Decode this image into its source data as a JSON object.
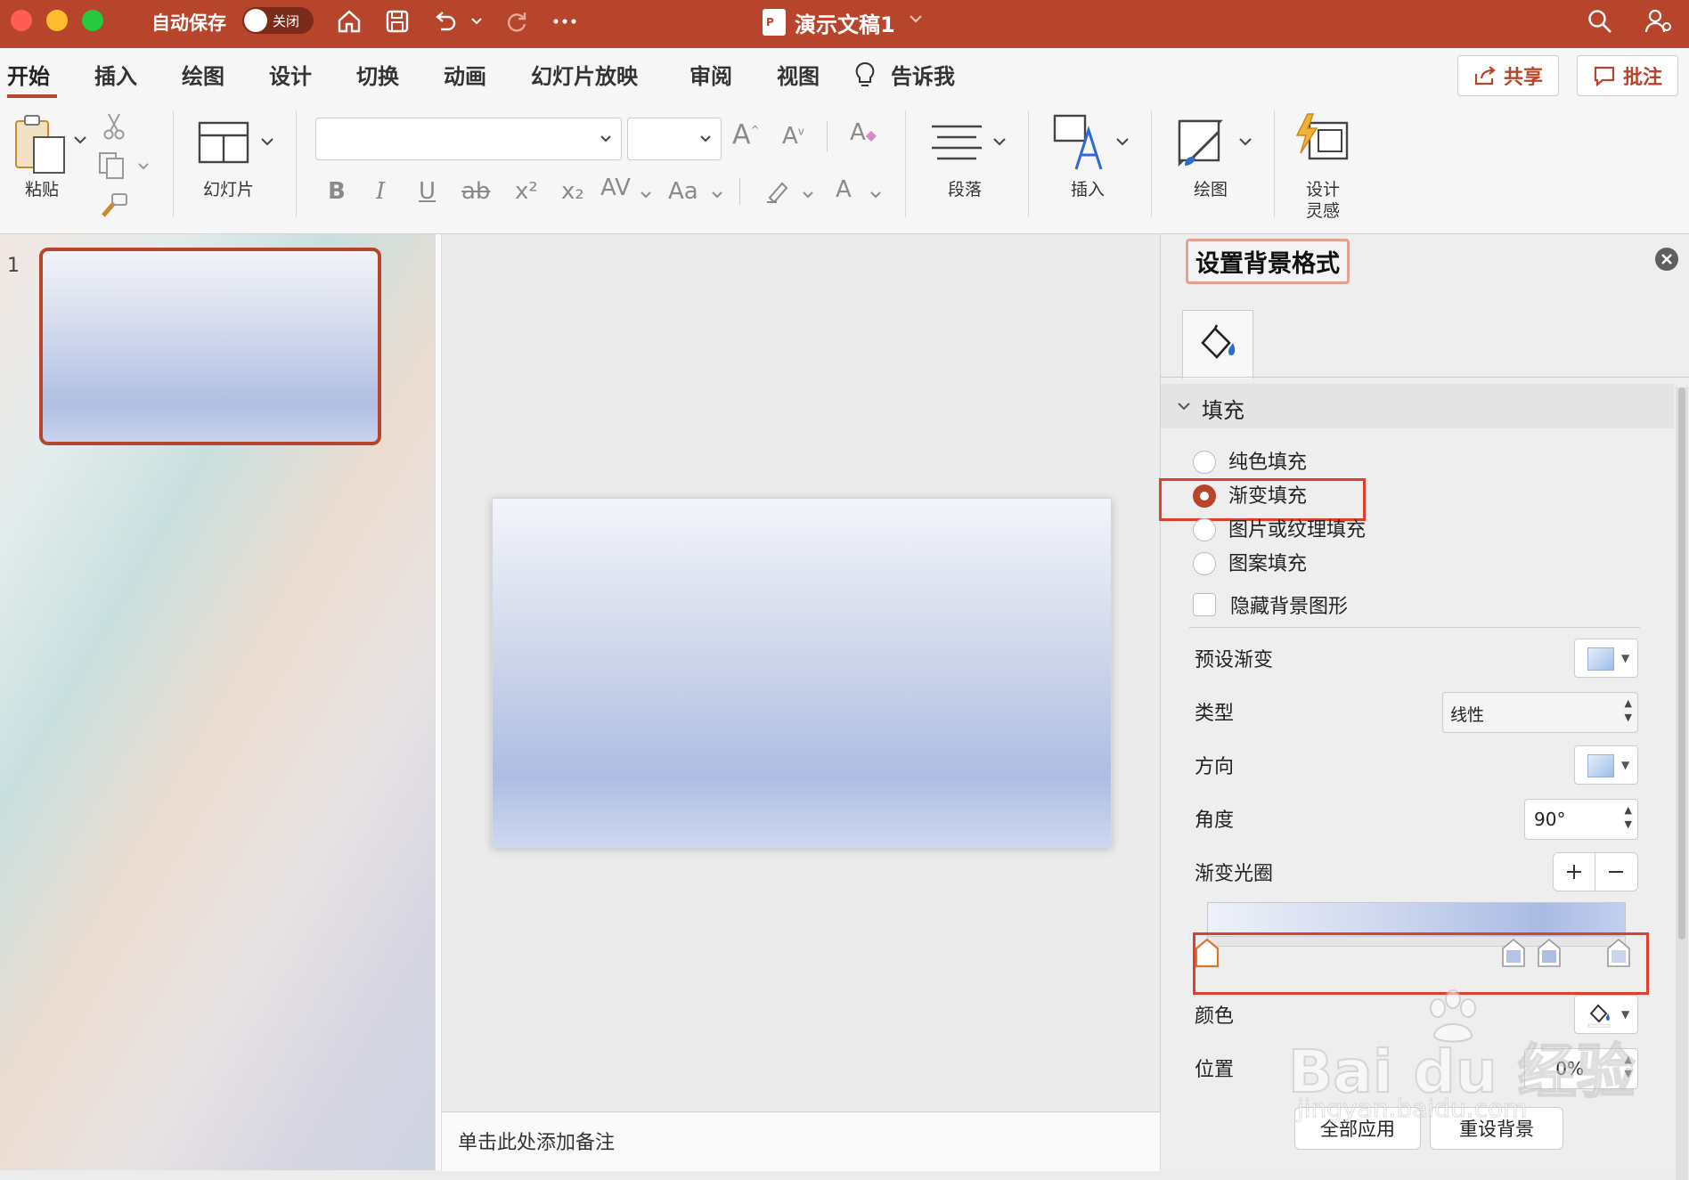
{
  "titlebar": {
    "autosave_label": "自动保存",
    "autosave_state": "关闭",
    "doc_title": "演示文稿1",
    "colors": {
      "bar": "#b6452c",
      "close": "#ff5f57",
      "minimize": "#febc2e",
      "zoom": "#28c840"
    }
  },
  "tabs": [
    "开始",
    "插入",
    "绘图",
    "设计",
    "切换",
    "动画",
    "幻灯片放映",
    "审阅",
    "视图",
    "告诉我"
  ],
  "active_tab": "开始",
  "header_buttons": {
    "share": "共享",
    "comments": "批注"
  },
  "ribbon": {
    "paste": "粘贴",
    "slide": "幻灯片",
    "font_name": "",
    "font_size": "",
    "format_buttons": [
      "B",
      "I",
      "U",
      "ab",
      "x²",
      "x₂",
      "AV",
      "Aa",
      "A"
    ],
    "paragraph": "段落",
    "insert": "插入",
    "draw": "绘图",
    "designer_line1": "设计",
    "designer_line2": "灵感"
  },
  "thumbnails": {
    "slide_number": "1"
  },
  "notes_placeholder": "单击此处添加备注",
  "format_pane": {
    "title": "设置背景格式",
    "section": "填充",
    "fill_options": [
      {
        "label": "纯色填充",
        "selected": false
      },
      {
        "label": "渐变填充",
        "selected": true
      },
      {
        "label": "图片或纹理填充",
        "selected": false
      },
      {
        "label": "图案填充",
        "selected": false
      }
    ],
    "hide_bg_graphics": "隐藏背景图形",
    "preset_label": "预设渐变",
    "type_label": "类型",
    "type_value": "线性",
    "direction_label": "方向",
    "angle_label": "角度",
    "angle_value": "90°",
    "stops_label": "渐变光圈",
    "color_label": "颜色",
    "position_label": "位置",
    "position_value": "0%",
    "apply_all": "全部应用",
    "reset_bg": "重设背景",
    "accent_color": "#b6452c",
    "highlight_color": "#e0402b"
  },
  "watermark": {
    "brand": "Bai du 经验",
    "url": "jingyan.baidu.com"
  }
}
